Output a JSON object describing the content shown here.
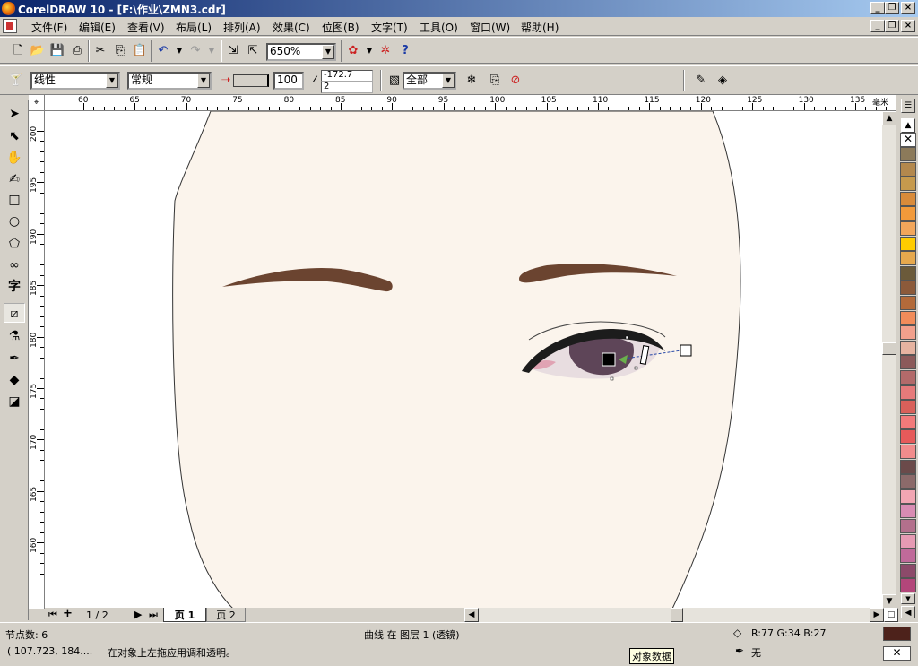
{
  "window": {
    "title": "CorelDRAW 10 - [F:\\作业\\ZMN3.cdr]"
  },
  "menu": [
    "文件(F)",
    "编辑(E)",
    "查看(V)",
    "布局(L)",
    "排列(A)",
    "效果(C)",
    "位图(B)",
    "文字(T)",
    "工具(O)",
    "窗口(W)",
    "帮助(H)"
  ],
  "standard_toolbar": {
    "zoom": "650%"
  },
  "property_bar": {
    "transparency_type": "线性",
    "merge_mode": "常规",
    "midpoint": "100",
    "angle": "-172.7",
    "edge_pad": "2",
    "target": "全部"
  },
  "ruler": {
    "unit": "毫米",
    "h_ticks": [
      "60",
      "65",
      "70",
      "75",
      "80",
      "85",
      "90",
      "95",
      "100",
      "105",
      "110",
      "115",
      "120",
      "125",
      "130",
      "135"
    ],
    "v_ticks": [
      "200",
      "195",
      "190",
      "185",
      "180",
      "175",
      "170",
      "165",
      "160"
    ]
  },
  "page_nav": {
    "counter": "1 / 2",
    "tabs": [
      "页 1",
      "页 2"
    ]
  },
  "status": {
    "nodes": "节点数: 6",
    "object_info": "曲线 在 图层 1  (透镜)",
    "fill_rgb": "R:77 G:34 B:27",
    "coords": "( 107.723, 184....",
    "hint": "在对象上左拖应用调和透明。",
    "outline": "无",
    "tooltip": "对象数据"
  },
  "colors": {
    "fill_swatch": "#4d221b",
    "skin": "#fbf4ec",
    "brow": "#6b4430",
    "iris": "#5e4558"
  },
  "palette_colors": [
    "#8c7a5a",
    "#b3884d",
    "#c69a4d",
    "#d98b3a",
    "#f29a3a",
    "#f2a65a",
    "#ffcc00",
    "#e6a84d",
    "#6b5a3a",
    "#8c5a3a",
    "#b36a3a",
    "#f28c5a",
    "#f2a08c",
    "#e6b3a0",
    "#8c5a5a",
    "#b36a6a",
    "#e67a7a",
    "#d9605a",
    "#f27a7a",
    "#e65a5a",
    "#f28c8c",
    "#6b4a4a",
    "#8c6a6a",
    "#f2a6b3",
    "#d98cb3",
    "#b3708c",
    "#e69ab3",
    "#c06a9a",
    "#8c4a6a",
    "#b3467a"
  ]
}
